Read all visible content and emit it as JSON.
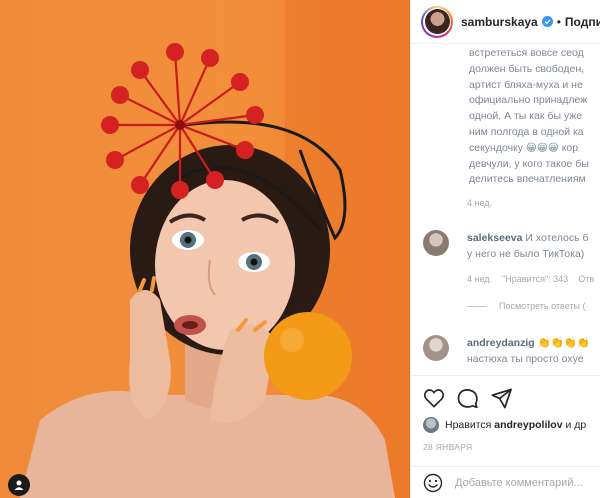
{
  "post": {
    "image_alt": "",
    "user_tag_icon": "person-icon"
  },
  "header": {
    "username": "samburskaya",
    "verified_icon": "verified-badge-icon",
    "separator": "•",
    "follow_label": "Подпи"
  },
  "caption": {
    "lines": [
      "встрететься вовсе сеод",
      "должен быть свободен,",
      "артист бляха-муха и не",
      "официально принадлеж",
      "одной. А ты как бы уже",
      "ним полгода в одной ка",
      "секундочку 😀😀😀 кор",
      "девчули, у кого такое бы",
      "делитесь впечатлениям"
    ],
    "time": "4 нед."
  },
  "comments": [
    {
      "username": "salekseeva",
      "lines": [
        "И хотелось б",
        "у него не было ТикТока)"
      ],
      "time": "4 нед.",
      "likes": "\"Нравится\": 343",
      "reply": "Отв",
      "view_replies": "Посмотреть ответы ("
    },
    {
      "username": "andreydanzig",
      "lines": [
        "👏👏👏👏",
        "настюха ты просто охуе"
      ]
    }
  ],
  "actions": {
    "like_icon": "heart-icon",
    "comment_icon": "comment-icon",
    "share_icon": "share-icon"
  },
  "likes": {
    "prefix": "Нравится",
    "user": "andreypolilov",
    "suffix": "и др"
  },
  "date": "28 января",
  "add_comment": {
    "placeholder": "Добавьте комментарий...",
    "emoji_icon": "smiley-icon"
  },
  "colors": {
    "background_orange": "#f08a3a",
    "verified_blue": "#3897f0",
    "text_primary": "#262626",
    "text_muted": "#a8a8a8"
  }
}
